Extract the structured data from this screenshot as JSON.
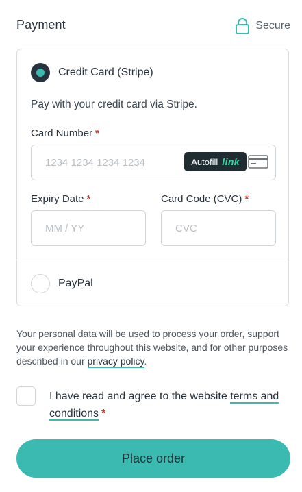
{
  "header": {
    "title": "Payment",
    "secure_label": "Secure"
  },
  "methods": {
    "credit_card": {
      "label": "Credit Card (Stripe)",
      "selected": true,
      "description": "Pay with your credit card via Stripe.",
      "card_number_label": "Card Number",
      "card_number_placeholder": "1234 1234 1234 1234",
      "autofill_label": "Autofill",
      "autofill_brand": "link",
      "expiry_label": "Expiry Date",
      "expiry_placeholder": "MM / YY",
      "cvc_label": "Card Code (CVC)",
      "cvc_placeholder": "CVC",
      "required_mark": "*"
    },
    "paypal": {
      "label": "PayPal",
      "selected": false
    }
  },
  "privacy": {
    "text_before": "Your personal data will be used to process your order, support your experience throughout this website, and for other purposes described in our ",
    "link_text": "privacy policy",
    "text_after": "."
  },
  "terms": {
    "text_before": "I have read and agree to the website ",
    "link_text": "terms and conditions",
    "required_mark": "*",
    "checked": false
  },
  "place_order_label": "Place order",
  "colors": {
    "accent": "#3bbab1",
    "dark": "#26323d",
    "required": "#d9302c",
    "link_brand": "#33d9a0"
  },
  "icons": {
    "secure": "lock-icon",
    "card": "credit-card-icon"
  }
}
